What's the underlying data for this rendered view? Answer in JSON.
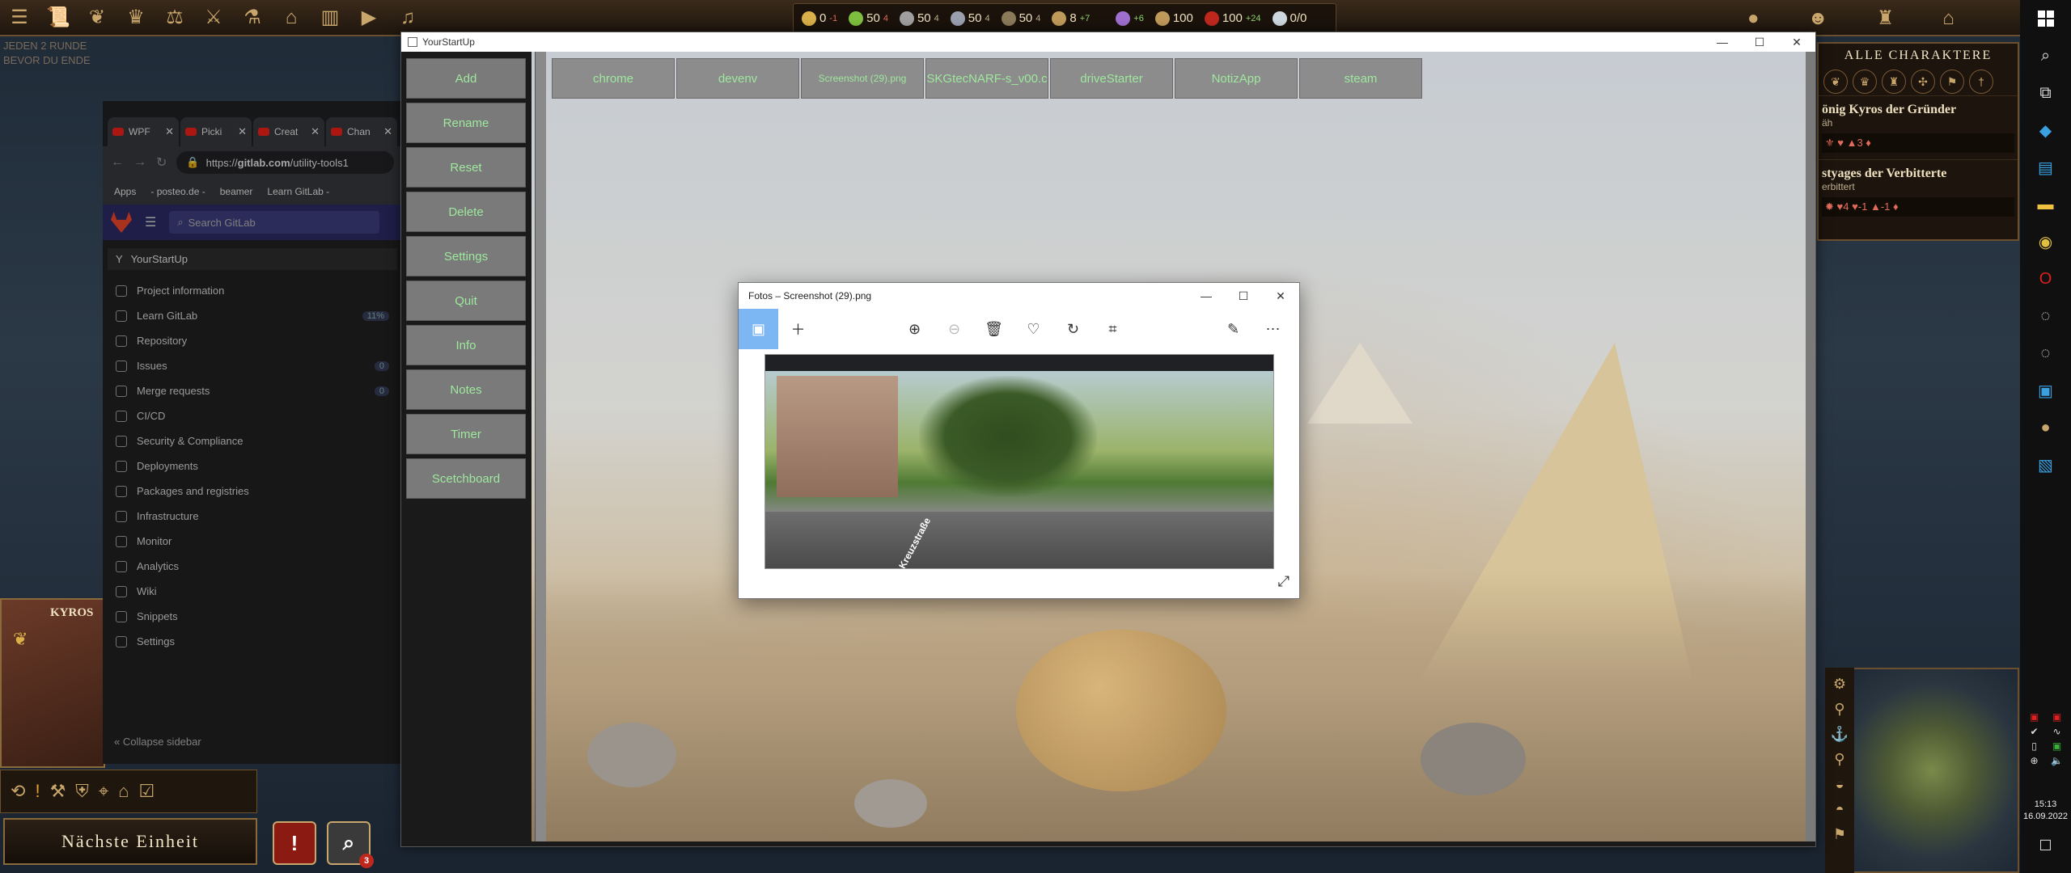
{
  "game": {
    "top_icons": [
      "menu-icon",
      "scroll-icon",
      "laurel-icon",
      "crown-icon",
      "scales-icon",
      "swords-icon",
      "flask-icon",
      "house-icon",
      "graph-icon",
      "play-icon",
      "music-icon"
    ],
    "resources": [
      {
        "name": "gold",
        "value": "0",
        "delta": "-1",
        "neg": true,
        "color": "#d9b04a"
      },
      {
        "name": "food",
        "value": "50",
        "delta": "4",
        "neg": true,
        "color": "#7fbf3f"
      },
      {
        "name": "wood",
        "value": "50",
        "sub": "4",
        "color": "#a0a0a0"
      },
      {
        "name": "stone",
        "value": "50",
        "sub": "4",
        "color": "#9aa0b0"
      },
      {
        "name": "tree",
        "value": "50",
        "sub": "4",
        "color": "#8a7a5a"
      },
      {
        "name": "goods",
        "value": "8",
        "delta": "+7",
        "color": "#c09a5a"
      }
    ],
    "resources_right": [
      {
        "name": "science",
        "value": "+6",
        "color": "#a070d0"
      },
      {
        "name": "influence",
        "value": "100",
        "color": "#c09a5a"
      },
      {
        "name": "military",
        "value": "100",
        "delta": "+24",
        "color": "#c0281e"
      },
      {
        "name": "diamond",
        "value": "0/0",
        "color": "#cfd8e0"
      }
    ],
    "right_icons": [
      "bulb-icon",
      "people-icon",
      "helmet-icon",
      "home-icon"
    ],
    "ghost_text": [
      "JEDEN 2 RUNDE",
      "BEVOR DU ENDE"
    ],
    "char_panel": {
      "title": "Alle Charaktere",
      "tabs": [
        "laurel-icon",
        "crown-icon",
        "tower-icon",
        "compass-icon",
        "banner-icon",
        "sword-icon"
      ],
      "entries": [
        {
          "name": "önig Kyros der Gründer",
          "status": "äh",
          "stats": "⚜ ♥ ▲3 ♦"
        },
        {
          "name": "styages der Verbitterte",
          "status": "erbittert",
          "stats": "✹ ♥4 ♥-1 ▲-1 ♦"
        }
      ]
    },
    "unit_name": "KYROS",
    "unit_actions": [
      "loop-icon",
      "alert-icon",
      "hammer-icon",
      "shield-icon",
      "telescope-icon",
      "house-icon",
      "check-icon"
    ],
    "next_unit": "Nächste Einheit",
    "alert_badge": "3"
  },
  "browser": {
    "tabs": [
      "WPF",
      "Picki",
      "Creat",
      "Chan"
    ],
    "url_prefix": "https://",
    "url_host": "gitlab.com",
    "url_path": "/utility-tools1",
    "bookmarks": [
      "Apps",
      "- posteo.de -",
      "beamer",
      "Learn GitLab -"
    ],
    "search_placeholder": "Search GitLab",
    "project": {
      "initial": "Y",
      "name": "YourStartUp"
    },
    "nav": [
      {
        "label": "Project information"
      },
      {
        "label": "Learn GitLab",
        "count": "11%"
      },
      {
        "label": "Repository"
      },
      {
        "label": "Issues",
        "count": "0"
      },
      {
        "label": "Merge requests",
        "count": "0"
      },
      {
        "label": "CI/CD"
      },
      {
        "label": "Security & Compliance"
      },
      {
        "label": "Deployments"
      },
      {
        "label": "Packages and registries"
      },
      {
        "label": "Infrastructure"
      },
      {
        "label": "Monitor"
      },
      {
        "label": "Analytics"
      },
      {
        "label": "Wiki"
      },
      {
        "label": "Snippets"
      },
      {
        "label": "Settings"
      }
    ],
    "collapse": "Collapse sidebar"
  },
  "ysu": {
    "title": "YourStartUp",
    "sidebar": [
      "Add",
      "Rename",
      "Reset",
      "Delete",
      "Settings",
      "Quit",
      "Info",
      "Notes",
      "Timer",
      "Scetchboard"
    ],
    "tiles": [
      "chrome",
      "devenv",
      "Screenshot (29).png",
      "SKGtecNARF-s_v00.c",
      "driveStarter",
      "NotizApp",
      "steam"
    ]
  },
  "fotos": {
    "title": "Fotos – Screenshot (29).png",
    "toolbar": [
      "image-icon",
      "add-icon",
      "zoom-in-icon",
      "zoom-out-icon",
      "delete-icon",
      "heart-icon",
      "rotate-icon",
      "crop-icon",
      "edit-icon",
      "more-icon"
    ],
    "street_label": "Kreuzstraße"
  },
  "taskbar": {
    "time": "15:13",
    "date": "16.09.2022"
  }
}
